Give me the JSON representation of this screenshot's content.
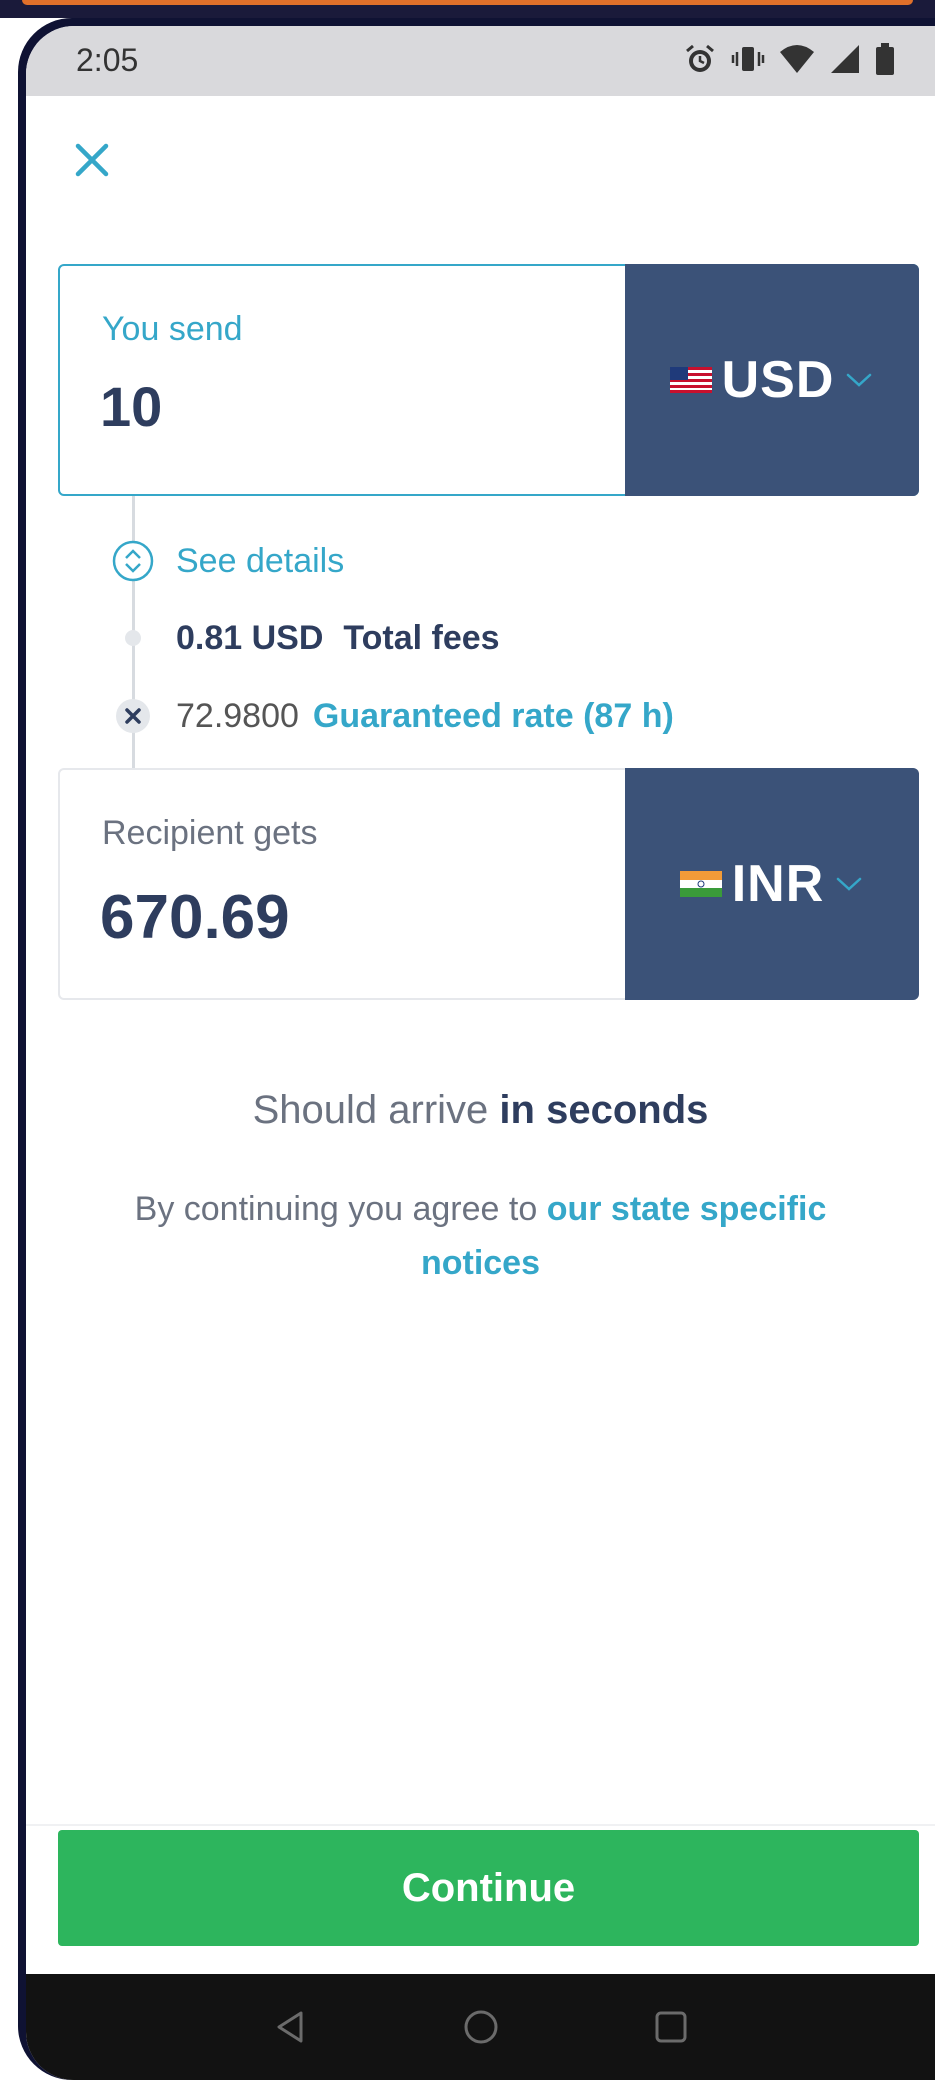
{
  "status_bar": {
    "time": "2:05"
  },
  "send": {
    "label": "You send",
    "amount": "10",
    "currency": "USD"
  },
  "details": {
    "see_details_label": "See details",
    "fee_amount": "0.81 USD",
    "fee_label": "Total fees",
    "rate_value": "72.9800",
    "rate_label": "Guaranteed rate (87 h)"
  },
  "receive": {
    "label": "Recipient gets",
    "amount": "670.69",
    "currency": "INR"
  },
  "arrival": {
    "prefix": "Should arrive",
    "emphasis": "in seconds"
  },
  "agreement": {
    "prefix": "By continuing you agree to",
    "link": "our state specific notices"
  },
  "continue_label": "Continue",
  "colors": {
    "accent": "#35a7c9",
    "currency_bg": "#3b5278",
    "continue_bg": "#2db55d",
    "text_dark": "#2e3d5e"
  },
  "icons": {
    "close": "close-icon",
    "currency_dropdown": "chevron-down-icon",
    "details_toggle": "expand-toggle-icon",
    "rate_multiply": "multiply-icon"
  }
}
